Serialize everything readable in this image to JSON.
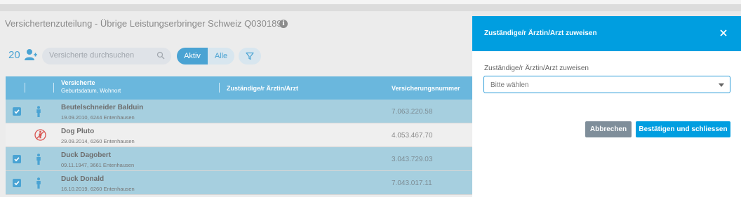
{
  "page": {
    "title": "Versichertenzuteilung - Übrige Leistungserbringer Schweiz Q030189",
    "info_icon": "i"
  },
  "toolbar": {
    "count": "20",
    "search_placeholder": "Versicherte durchsuchen",
    "toggle_active": "Aktiv",
    "toggle_all": "Alle"
  },
  "table": {
    "headers": {
      "insured": "Versicherte",
      "insured_sub": "Geburtsdatum, Wohnort",
      "doctor": "Zuständige/r Ärztin/Arzt",
      "number": "Versicherungsnummer"
    },
    "rows": [
      {
        "name": "Beutelschneider Balduin",
        "details": "19.09.2010, 6244 Entenhausen",
        "number": "7.063.220.58",
        "selected": true,
        "type": "person"
      },
      {
        "name": "Dog Pluto",
        "details": "29.09.2014, 6260 Entenhausen",
        "number": "4.053.467.70",
        "selected": false,
        "type": "animal"
      },
      {
        "name": "Duck Dagobert",
        "details": "09.11.1947, 3661 Entenhausen",
        "number": "3.043.729.03",
        "selected": true,
        "type": "person"
      },
      {
        "name": "Duck Donald",
        "details": "16.10.2019, 6260 Entenhausen",
        "number": "7.043.017.11",
        "selected": true,
        "type": "person"
      }
    ]
  },
  "dialog": {
    "title": "Zuständige/r Ärztin/Arzt zuweisen",
    "field_label": "Zuständige/r Ärztin/Arzt zuweisen",
    "select_placeholder": "Bitte wählen",
    "cancel_label": "Abbrechen",
    "confirm_label": "Bestätigen und schliessen"
  },
  "colors": {
    "accent": "#009ee0",
    "header_blue": "#6ab7dd",
    "selected_row": "#a6cfdf",
    "cancel_gray": "#7f8e9a"
  }
}
